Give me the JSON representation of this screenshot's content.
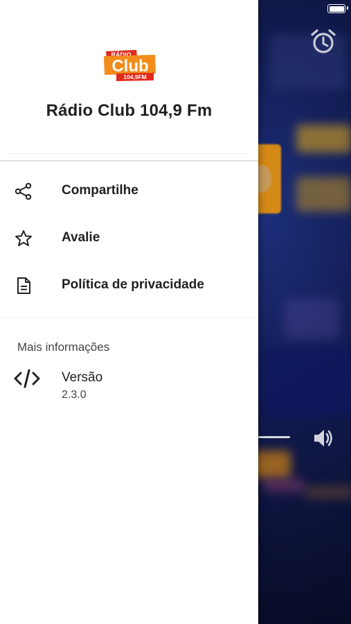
{
  "drawer": {
    "logo": {
      "top_text": "RÁDIO",
      "main_text": "Club",
      "sub_text": "104,9FM",
      "colors": {
        "orange": "#f28c1a",
        "red": "#e02a1d",
        "white": "#ffffff"
      }
    },
    "station_name": "Rádio Club 104,9 Fm",
    "menu": [
      {
        "label": "Compartilhe",
        "icon": "share-icon"
      },
      {
        "label": "Avalie",
        "icon": "star-icon"
      },
      {
        "label": "Política de privacidade",
        "icon": "document-icon"
      }
    ],
    "more_info": {
      "section_title": "Mais informações",
      "version_label": "Versão",
      "version_value": "2.3.0",
      "icon": "code-icon"
    }
  },
  "background_player": {
    "alarm_icon": "alarm-clock-icon",
    "volume_icon": "volume-icon",
    "colors": {
      "bg_dark": "#0c1230",
      "accent_orange": "#d58a17"
    }
  }
}
